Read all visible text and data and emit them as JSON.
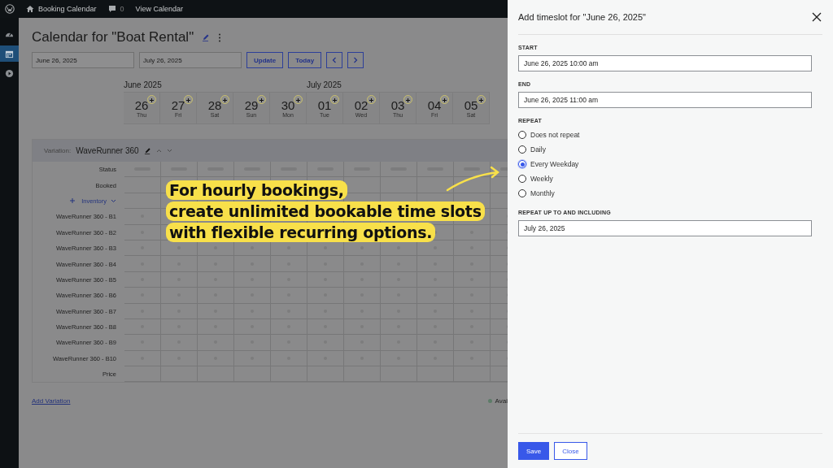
{
  "admin_bar": {
    "site": "Booking Calendar",
    "comments": "0",
    "link": "View Calendar"
  },
  "sidebar": {
    "items": [
      {
        "kind": "dashboard",
        "selected": false
      },
      {
        "kind": "calendar",
        "selected": true
      },
      {
        "kind": "play",
        "selected": false
      }
    ]
  },
  "page": {
    "title": "Calendar for \"Boat Rental\"",
    "start_date": "June 26, 2025",
    "end_date": "July 26, 2025",
    "buttons": [
      "Update",
      "Today"
    ]
  },
  "calendar": {
    "months": [
      {
        "label": "June 2025",
        "days": [
          {
            "day": "26",
            "weekday": "Thu"
          },
          {
            "day": "27",
            "weekday": "Fri"
          },
          {
            "day": "28",
            "weekday": "Sat"
          },
          {
            "day": "29",
            "weekday": "Sun"
          },
          {
            "day": "30",
            "weekday": "Mon"
          }
        ]
      },
      {
        "label": "July 2025",
        "days": [
          {
            "day": "01",
            "weekday": "Tue"
          },
          {
            "day": "02",
            "weekday": "Wed"
          },
          {
            "day": "03",
            "weekday": "Thu"
          },
          {
            "day": "04",
            "weekday": "Fri"
          },
          {
            "day": "05",
            "weekday": "Sat"
          }
        ]
      }
    ]
  },
  "variation": {
    "label": "Variation:",
    "name": "WaveRunner 360",
    "rows": [
      {
        "label": "Status",
        "kind": "status"
      },
      {
        "label": "Booked",
        "kind": "blank"
      },
      {
        "label": "Inventory",
        "kind": "inventory"
      },
      {
        "label": "WaveRunner 360 - B1",
        "kind": "unit"
      },
      {
        "label": "WaveRunner 360 - B2",
        "kind": "unit"
      },
      {
        "label": "WaveRunner 360 - B3",
        "kind": "unit"
      },
      {
        "label": "WaveRunner 360 - B4",
        "kind": "unit"
      },
      {
        "label": "WaveRunner 360 - B5",
        "kind": "unit"
      },
      {
        "label": "WaveRunner 360 - B6",
        "kind": "unit"
      },
      {
        "label": "WaveRunner 360 - B7",
        "kind": "unit"
      },
      {
        "label": "WaveRunner 360 - B8",
        "kind": "unit"
      },
      {
        "label": "WaveRunner 360 - B9",
        "kind": "unit"
      },
      {
        "label": "WaveRunner 360 - B10",
        "kind": "unit"
      },
      {
        "label": "Price",
        "kind": "blank"
      }
    ]
  },
  "add_variation": "Add Variation",
  "legend": "Avai",
  "annotation": {
    "lines": [
      "For hourly bookings,",
      "create unlimited bookable time slots",
      "with flexible recurring options."
    ]
  },
  "drawer": {
    "title": "Add timeslot for \"June 26, 2025\"",
    "start": {
      "label": "START",
      "value": "June 26, 2025 10:00 am"
    },
    "end": {
      "label": "END",
      "value": "June 26, 2025 11:00 am"
    },
    "repeat": {
      "label": "REPEAT",
      "options": [
        {
          "label": "Does not repeat",
          "selected": false
        },
        {
          "label": "Daily",
          "selected": false
        },
        {
          "label": "Every Weekday",
          "selected": true
        },
        {
          "label": "Weekly",
          "selected": false
        },
        {
          "label": "Monthly",
          "selected": false
        }
      ]
    },
    "until": {
      "label": "REPEAT UP TO AND INCLUDING",
      "value": "July 26, 2025"
    },
    "buttons": [
      "Save",
      "Close"
    ]
  }
}
